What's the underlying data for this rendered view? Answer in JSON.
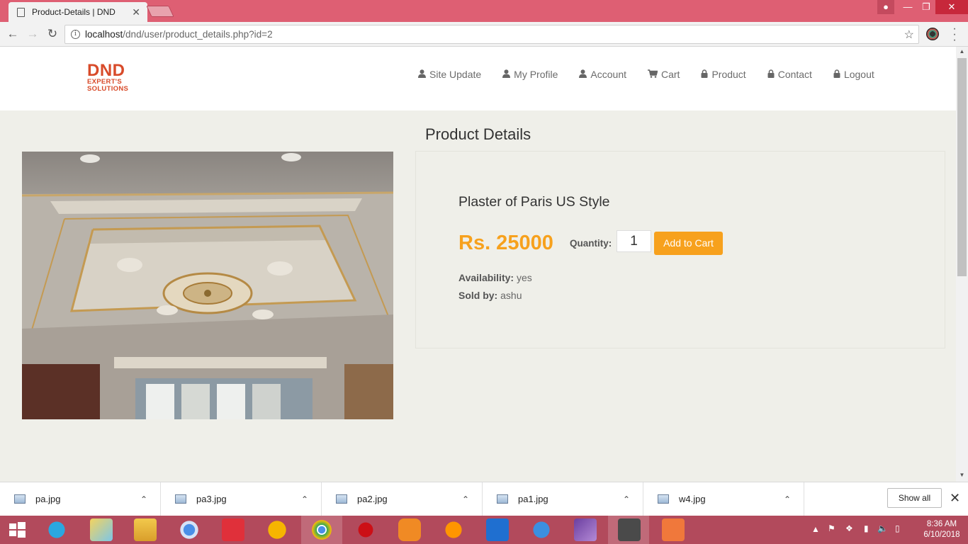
{
  "browser": {
    "tab_title": "Product-Details | DND",
    "tab_close": "✕",
    "url_host": "localhost",
    "url_path": "/dnd/user/product_details.php?id=2"
  },
  "site": {
    "logo_line1": "DND",
    "logo_line2": "EXPERT'S",
    "logo_line3": "SOLUTIONS",
    "nav": [
      {
        "label": "Site Update",
        "icon": "user-icon"
      },
      {
        "label": "My Profile",
        "icon": "user-icon"
      },
      {
        "label": "Account",
        "icon": "user-icon"
      },
      {
        "label": "Cart",
        "icon": "cart-icon"
      },
      {
        "label": "Product",
        "icon": "lock-icon"
      },
      {
        "label": "Contact",
        "icon": "lock-icon"
      },
      {
        "label": "Logout",
        "icon": "lock-icon"
      }
    ]
  },
  "product": {
    "heading": "Product Details",
    "name": "Plaster of Paris US Style",
    "price": "Rs. 25000",
    "quantity_label": "Quantity:",
    "quantity_value": "1",
    "add_to_cart": "Add to Cart",
    "availability_label": "Availability:",
    "availability_value": " yes",
    "sold_by_label": "Sold by:",
    "sold_by_value": " ashu"
  },
  "downloads": {
    "items": [
      "pa.jpg",
      "pa3.jpg",
      "pa2.jpg",
      "pa1.jpg",
      "w4.jpg"
    ],
    "show_all": "Show all"
  },
  "taskbar": {
    "time": "8:36 AM",
    "date": "6/10/2018"
  },
  "colors": {
    "accent": "#f7a11d",
    "brand": "#d84b2a",
    "chrome_frame": "#de5f73",
    "page_bg": "#efefe9"
  }
}
